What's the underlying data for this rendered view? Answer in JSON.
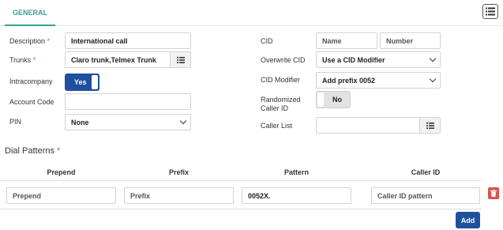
{
  "tabs": {
    "general": "GENERAL"
  },
  "toolbar": {
    "list_icon": "list-icon"
  },
  "form": {
    "description": {
      "label": "Description",
      "required": "*",
      "value": "International call"
    },
    "trunks": {
      "label": "Trunks",
      "required": "*",
      "value": "Claro trunk,Telmex Trunk"
    },
    "intracompany": {
      "label": "Intracompany",
      "state": "Yes"
    },
    "account_code": {
      "label": "Account Code",
      "value": ""
    },
    "pin": {
      "label": "PIN",
      "value": "None"
    },
    "cid": {
      "label": "CID",
      "name_placeholder": "Name",
      "number_placeholder": "Number"
    },
    "overwrite_cid": {
      "label": "Overwrite CID",
      "value": "Use a CID Modifier"
    },
    "cid_modifier": {
      "label": "CID Modifier",
      "value": "Add prefix 0052"
    },
    "randomized_caller_id": {
      "label_line1": "Randomized",
      "label_line2": "Caller ID",
      "state": "No"
    },
    "caller_list": {
      "label": "Caller List",
      "value": ""
    }
  },
  "dial_patterns": {
    "title": "Dial Patterns",
    "required": "*",
    "columns": [
      "Prepend",
      "Prefix",
      "Pattern",
      "Caller ID"
    ],
    "rows": [
      {
        "prepend_placeholder": "Prepend",
        "prefix_placeholder": "Prefix",
        "pattern": "0052X.",
        "separator": "/",
        "caller_id_placeholder": "Caller ID pattern"
      }
    ],
    "add_label": "Add"
  },
  "colors": {
    "accent": "#3aa08e",
    "primary": "#1f4f9f",
    "danger": "#d9534f"
  }
}
